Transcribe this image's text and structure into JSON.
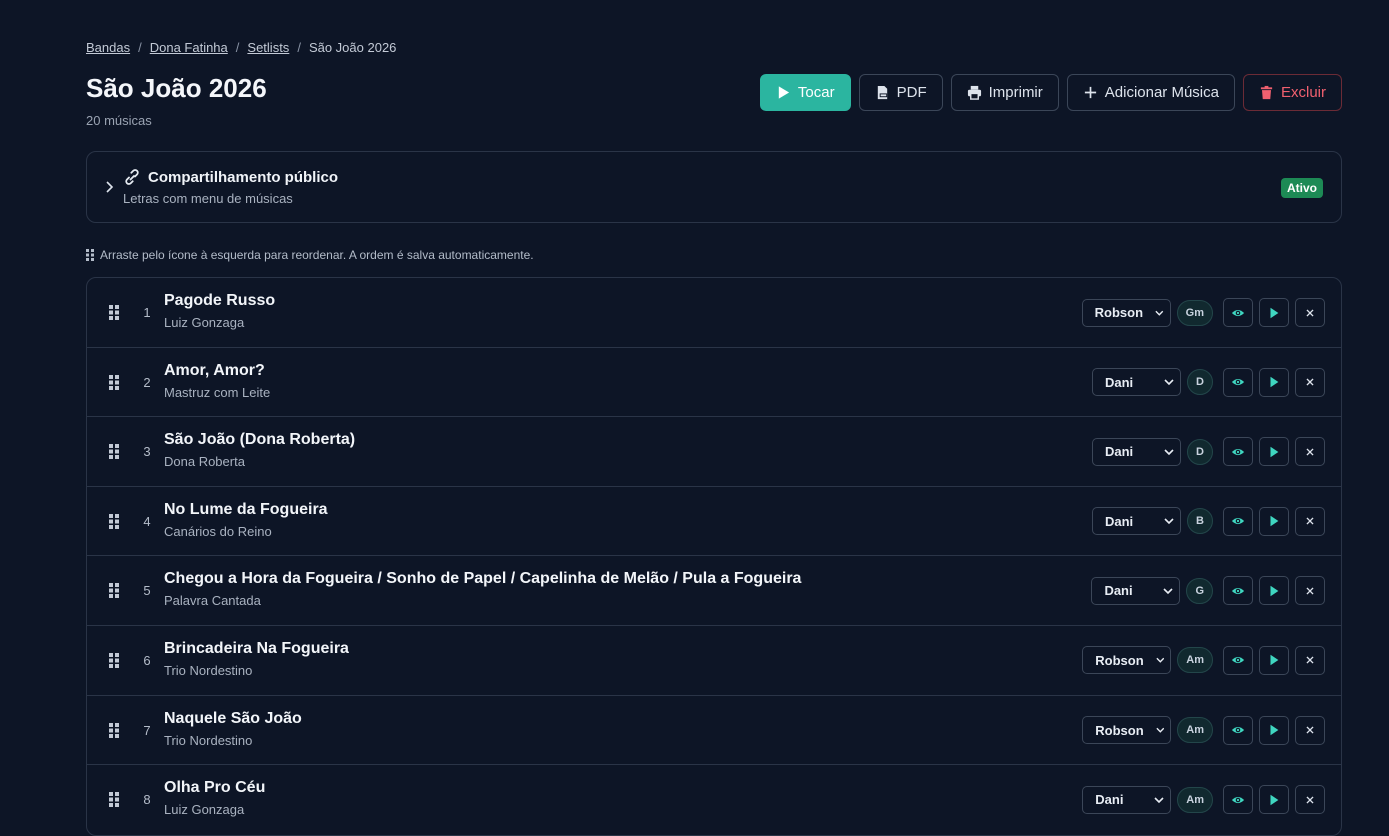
{
  "breadcrumb": {
    "items": [
      "Bandas",
      "Dona Fatinha",
      "Setlists"
    ],
    "current": "São João 2026",
    "separator": "/"
  },
  "header": {
    "title": "São João 2026",
    "subtitle": "20 músicas"
  },
  "actions": {
    "play": "Tocar",
    "pdf": "PDF",
    "print": "Imprimir",
    "add": "Adicionar Música",
    "delete": "Excluir"
  },
  "share": {
    "title": "Compartilhamento público",
    "subtitle": "Letras com menu de músicas",
    "status": "Ativo"
  },
  "hint": "Arraste pelo ícone à esquerda para reordenar. A ordem é salva automaticamente.",
  "songs": [
    {
      "n": "1",
      "title": "Pagode Russo",
      "artist": "Luiz Gonzaga",
      "singer": "Robson",
      "key": "Gm"
    },
    {
      "n": "2",
      "title": "Amor, Amor?",
      "artist": "Mastruz com Leite",
      "singer": "Dani",
      "key": "D"
    },
    {
      "n": "3",
      "title": "São João (Dona Roberta)",
      "artist": "Dona Roberta",
      "singer": "Dani",
      "key": "D"
    },
    {
      "n": "4",
      "title": "No Lume da Fogueira",
      "artist": "Canários do Reino",
      "singer": "Dani",
      "key": "B"
    },
    {
      "n": "5",
      "title": "Chegou a Hora da Fogueira / Sonho de Papel / Capelinha de Melão / Pula a Fogueira",
      "artist": "Palavra Cantada",
      "singer": "Dani",
      "key": "G"
    },
    {
      "n": "6",
      "title": "Brincadeira Na Fogueira",
      "artist": "Trio Nordestino",
      "singer": "Robson",
      "key": "Am"
    },
    {
      "n": "7",
      "title": "Naquele São João",
      "artist": "Trio Nordestino",
      "singer": "Robson",
      "key": "Am"
    },
    {
      "n": "8",
      "title": "Olha Pro Céu",
      "artist": "Luiz Gonzaga",
      "singer": "Dani",
      "key": "Am"
    }
  ],
  "colors": {
    "background": "#0d1526",
    "accent": "#2bb5a0",
    "danger": "#f0606f",
    "active_badge": "#1d8a55",
    "border": "#2a3447"
  },
  "icons": {
    "play": "play-icon",
    "pdf": "pdf-file-icon",
    "print": "printer-icon",
    "add": "plus-icon",
    "delete": "trash-icon",
    "share": "link-icon",
    "expand": "chevron-right-icon",
    "drag": "grip-icon",
    "view": "eye-icon",
    "remove": "close-icon"
  }
}
